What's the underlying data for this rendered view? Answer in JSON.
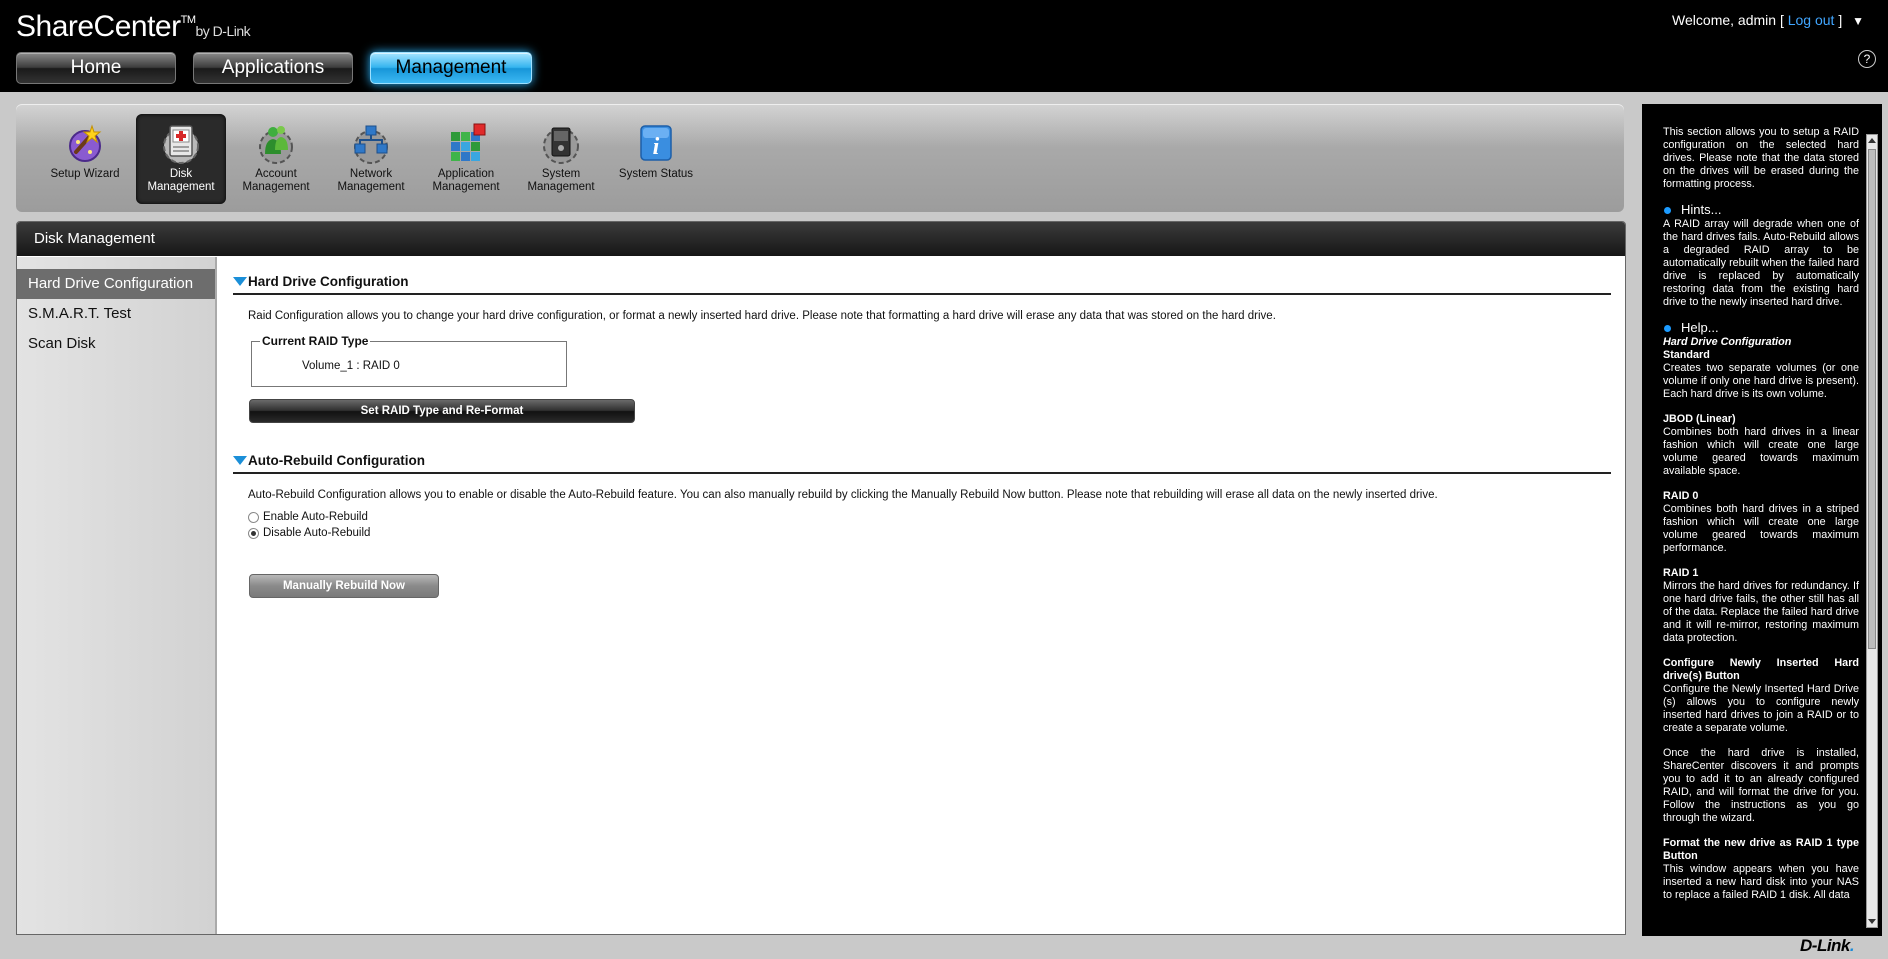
{
  "app": {
    "brand": "ShareCenter",
    "trademark": "TM",
    "by": "by D-Link",
    "welcome_prefix": "Welcome, admin [",
    "logout_label": "Log out",
    "welcome_suffix": "]",
    "help_symbol": "?"
  },
  "nav": {
    "tabs": [
      {
        "label": "Home",
        "active": false
      },
      {
        "label": "Applications",
        "active": false
      },
      {
        "label": "Management",
        "active": true
      }
    ]
  },
  "toolbar": {
    "items": [
      {
        "line1": "Setup Wizard",
        "line2": "",
        "icon": "wizard-icon"
      },
      {
        "line1": "Disk",
        "line2": "Management",
        "icon": "disk-icon",
        "active": true
      },
      {
        "line1": "Account",
        "line2": "Management",
        "icon": "account-icon"
      },
      {
        "line1": "Network",
        "line2": "Management",
        "icon": "network-icon"
      },
      {
        "line1": "Application",
        "line2": "Management",
        "icon": "application-icon"
      },
      {
        "line1": "System",
        "line2": "Management",
        "icon": "system-icon"
      },
      {
        "line1": "System Status",
        "line2": "",
        "icon": "info-icon"
      }
    ]
  },
  "panel": {
    "title": "Disk Management",
    "menu": [
      {
        "label": "Hard Drive Configuration",
        "active": true
      },
      {
        "label": "S.M.A.R.T. Test",
        "active": false
      },
      {
        "label": "Scan Disk",
        "active": false
      }
    ]
  },
  "hdc": {
    "title": "Hard Drive Configuration",
    "description": "Raid Configuration allows you to change your hard drive configuration, or format a newly inserted hard drive. Please note that formatting a hard drive will erase any data that was stored on the hard drive.",
    "current_raid_label": "Current RAID Type",
    "current_raid_value": "Volume_1 : RAID 0",
    "set_button": "Set RAID Type and Re-Format"
  },
  "arc": {
    "title": "Auto-Rebuild Configuration",
    "description": "Auto-Rebuild Configuration allows you to enable or disable the Auto-Rebuild feature. You can also manually rebuild by clicking the Manually Rebuild Now button. Please note that rebuilding will erase all data on the newly inserted drive.",
    "enable_label": "Enable Auto-Rebuild",
    "disable_label": "Disable Auto-Rebuild",
    "selected": "disable",
    "rebuild_button": "Manually Rebuild Now"
  },
  "help": {
    "intro": "This section allows you to setup a RAID configuration on the selected hard drives. Please note that the data stored on the drives will be erased during the formatting process.",
    "hints_title": "Hints...",
    "hints_text": "A RAID array will degrade when one of the hard drives fails. Auto-Rebuild allows a degraded RAID array to be automatically rebuilt when the failed hard drive is replaced by automatically restoring data from the existing hard drive to the newly inserted hard drive.",
    "help_title": "Help...",
    "hdc_title": "Hard Drive Configuration",
    "standard_title": "Standard",
    "standard_text": "Creates two separate volumes (or one volume if only one hard drive is present). Each hard drive is its own volume.",
    "jbod_title": "JBOD (Linear)",
    "jbod_text": "Combines both hard drives in a linear fashion which will create one large volume geared towards maximum available space.",
    "raid0_title": "RAID 0",
    "raid0_text": "Combines both hard drives in a striped fashion which will create one large volume geared towards maximum performance.",
    "raid1_title": "RAID 1",
    "raid1_text": "Mirrors the hard drives for redundancy. If one hard drive fails, the other still has all of the data. Replace the failed hard drive and it will re-mirror, restoring maximum data protection.",
    "configure_title": "Configure Newly Inserted Hard drive(s) Button",
    "configure_text": "Configure the Newly Inserted Hard Drive (s) allows you to configure newly inserted hard drives to join a RAID or to create a separate volume.",
    "once_text": "Once the hard drive is installed, ShareCenter discovers it and prompts you to add it to an already configured RAID, and will format the drive for you. Follow the instructions as you go through the wizard.",
    "format_title": "Format the new drive as RAID 1 type Button",
    "format_text": "This window appears when you have inserted a new hard disk into your NAS to replace a failed RAID 1 disk. All data"
  },
  "footer": {
    "logo": "D-Link"
  },
  "colors": {
    "accent": "#2bb6ff",
    "section_triangle": "#1b8fd8",
    "link": "#41a6ff"
  }
}
